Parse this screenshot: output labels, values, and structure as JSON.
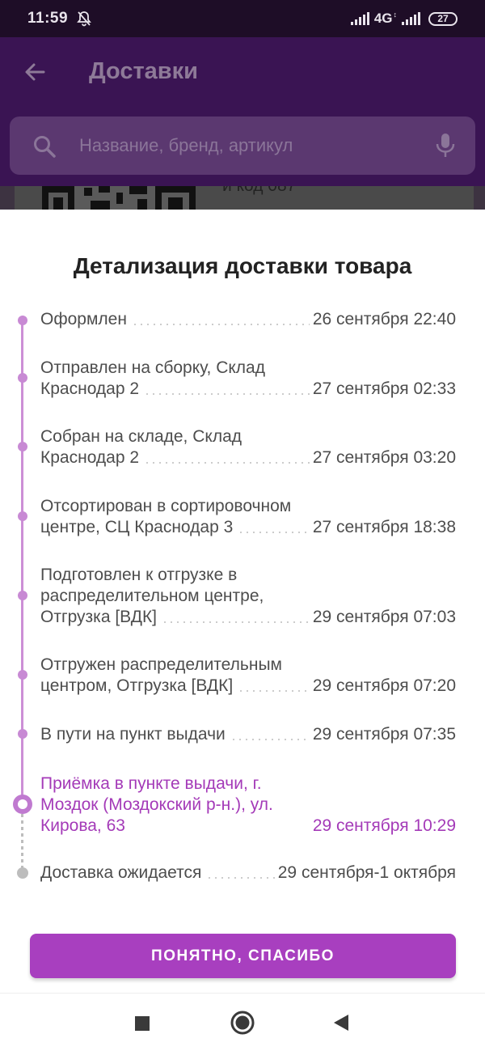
{
  "status_bar": {
    "time": "11:59",
    "network": "4G",
    "battery": "27",
    "icons": [
      "bell-off-icon",
      "signal-icon",
      "signal-icon",
      "battery-icon"
    ]
  },
  "app_bar": {
    "title": "Доставки",
    "back_icon": "arrow-left-icon"
  },
  "search": {
    "placeholder": "Название, бренд, артикул",
    "search_icon": "search-icon",
    "mic_icon": "microphone-icon"
  },
  "background_card": {
    "code_text": "и код 087"
  },
  "sheet": {
    "title": "Детализация доставки товара",
    "events": [
      {
        "lines": [
          "Оформлен"
        ],
        "date": "26 сентября 22:40",
        "state": "done"
      },
      {
        "lines": [
          "Отправлен на сборку, Склад",
          "Краснодар 2"
        ],
        "date": "27 сентября 02:33",
        "state": "done"
      },
      {
        "lines": [
          "Собран на складе, Склад",
          "Краснодар 2"
        ],
        "date": "27 сентября 03:20",
        "state": "done"
      },
      {
        "lines": [
          "Отсортирован в сортировочном",
          "центре, СЦ Краснодар 3"
        ],
        "date": "27 сентября 18:38",
        "state": "done"
      },
      {
        "lines": [
          "Подготовлен к отгрузке в",
          "распределительном центре,",
          "Отгрузка [ВДК]"
        ],
        "date": "29 сентября 07:03",
        "state": "done"
      },
      {
        "lines": [
          "Отгружен распределительным",
          "центром, Отгрузка [ВДК]"
        ],
        "date": "29 сентября 07:20",
        "state": "done"
      },
      {
        "lines": [
          "В пути на пункт выдачи"
        ],
        "date": "29 сентября 07:35",
        "state": "done"
      },
      {
        "lines": [
          "Приёмка в пункте выдачи, г.",
          "Моздок (Моздокский р-н.), ул.",
          "Кирова, 63"
        ],
        "date": "29 сентября 10:29",
        "state": "active"
      },
      {
        "lines": [
          "Доставка ожидается"
        ],
        "date": "29 сентября-1 октября",
        "state": "pending"
      }
    ],
    "ok_button_label": "ПОНЯТНО, СПАСИБО"
  },
  "colors": {
    "accent": "#a83fbf",
    "timeline": "#cc8fd6",
    "active_text": "#a43ab8",
    "pending": "#bdbdbd"
  },
  "nav_bar": {
    "icons": [
      "recent-apps-icon",
      "home-icon",
      "back-icon"
    ]
  }
}
